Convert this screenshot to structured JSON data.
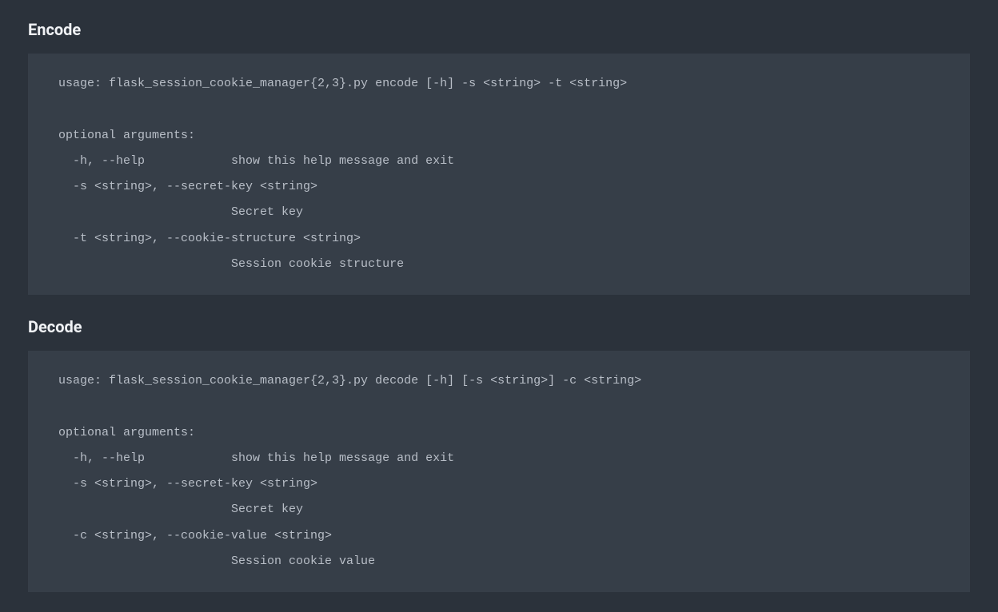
{
  "sections": [
    {
      "heading": "Encode",
      "code": "usage: flask_session_cookie_manager{2,3}.py encode [-h] -s <string> -t <string>\n\noptional arguments:\n  -h, --help            show this help message and exit\n  -s <string>, --secret-key <string>\n                        Secret key\n  -t <string>, --cookie-structure <string>\n                        Session cookie structure"
    },
    {
      "heading": "Decode",
      "code": "usage: flask_session_cookie_manager{2,3}.py decode [-h] [-s <string>] -c <string>\n\noptional arguments:\n  -h, --help            show this help message and exit\n  -s <string>, --secret-key <string>\n                        Secret key\n  -c <string>, --cookie-value <string>\n                        Session cookie value"
    }
  ]
}
